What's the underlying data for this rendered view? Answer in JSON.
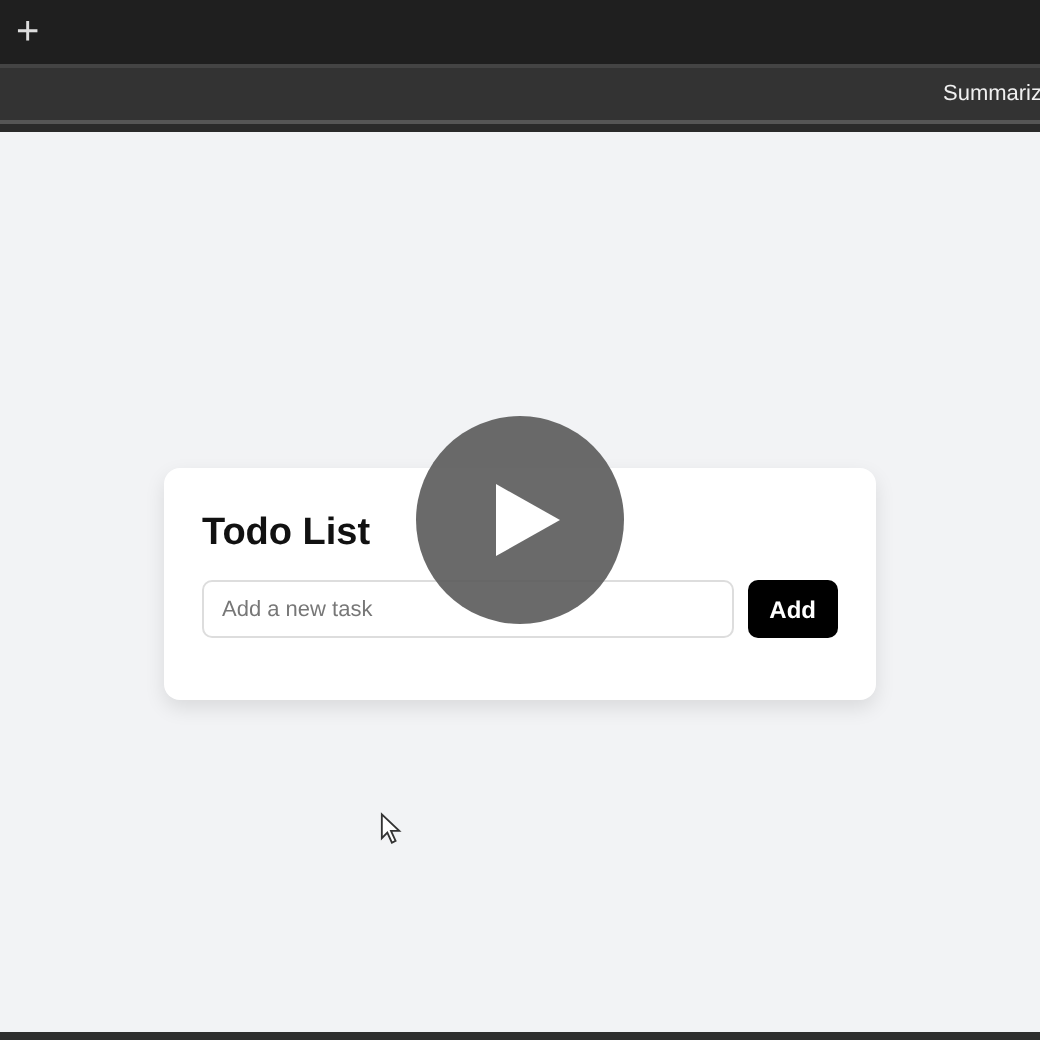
{
  "tab_bar": {
    "new_tab": "+"
  },
  "toolbar": {
    "label": "Summariz"
  },
  "todo_card": {
    "title": "Todo List",
    "input": {
      "placeholder": "Add a new task"
    },
    "button": "Add"
  }
}
